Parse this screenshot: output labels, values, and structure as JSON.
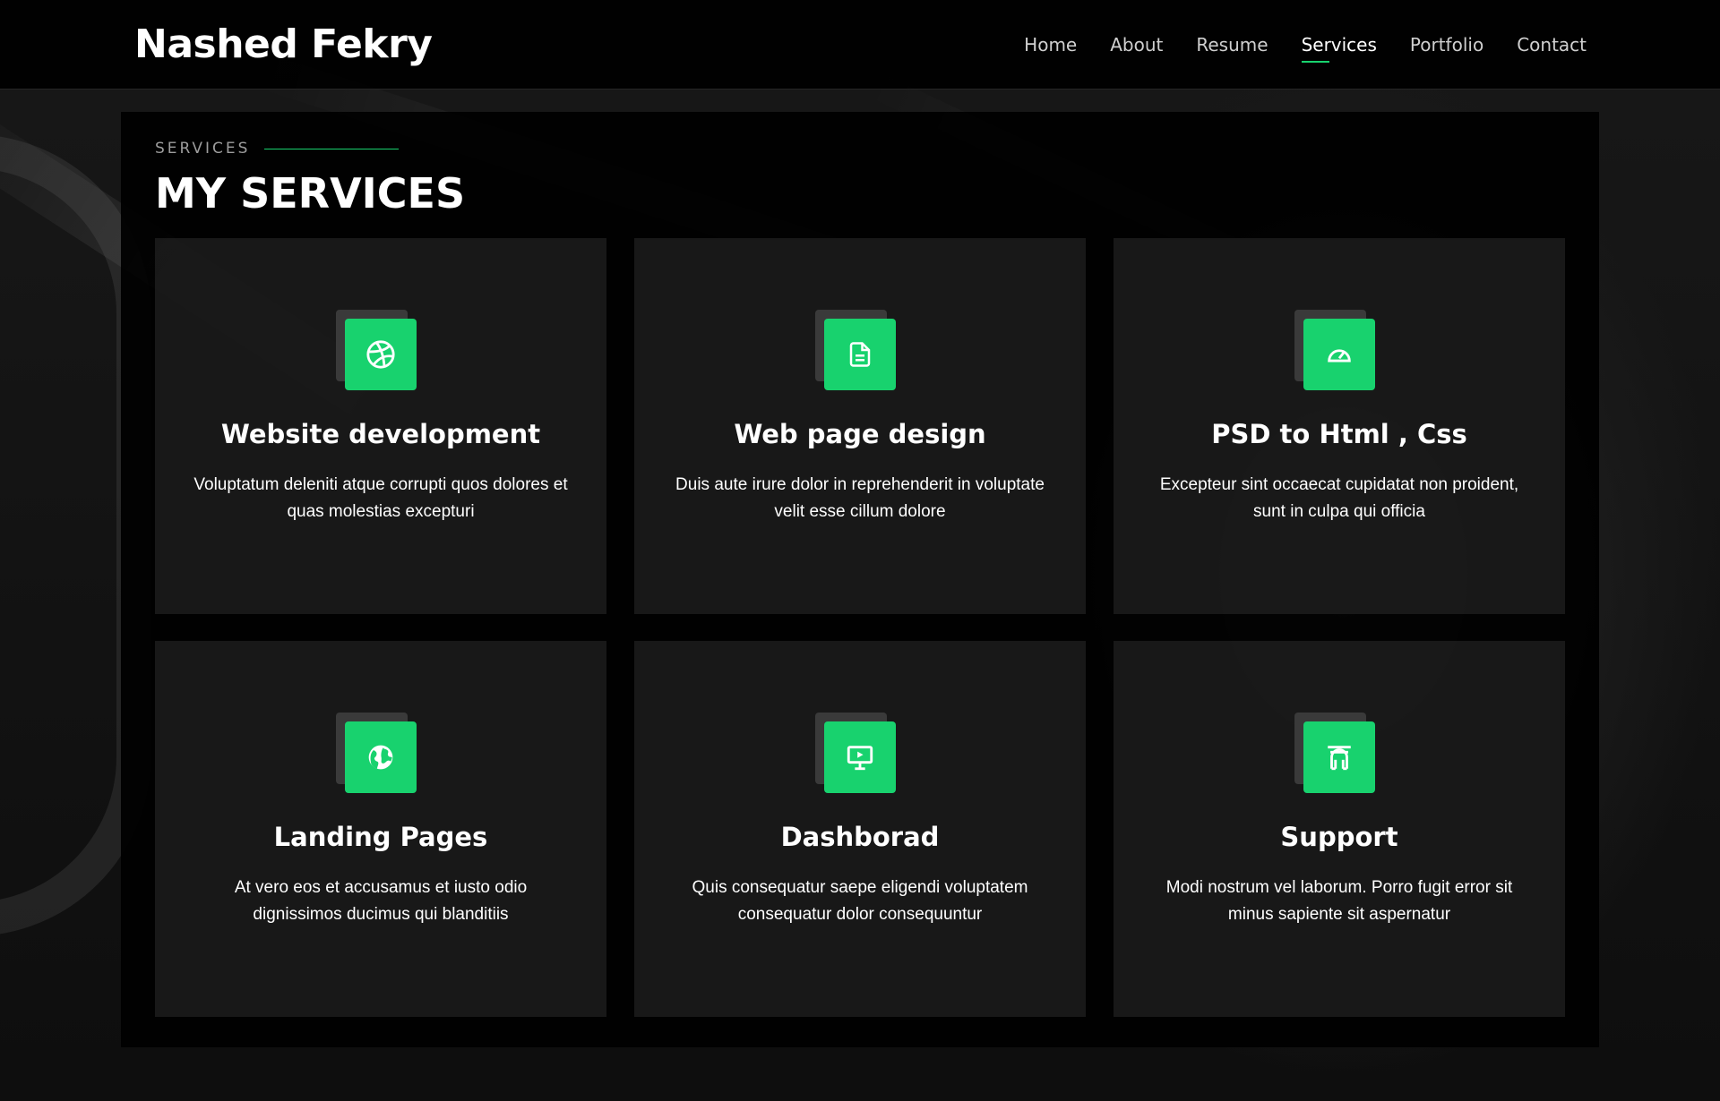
{
  "header": {
    "logo": "Nashed Fekry",
    "nav": [
      {
        "label": "Home"
      },
      {
        "label": "About"
      },
      {
        "label": "Resume"
      },
      {
        "label": "Services",
        "active": true
      },
      {
        "label": "Portfolio"
      },
      {
        "label": "Contact"
      }
    ]
  },
  "section": {
    "subtitle": "SERVICES",
    "title": "MY SERVICES",
    "services": [
      {
        "icon": "dribbble-icon",
        "title": "Website development",
        "description": "Voluptatum deleniti atque corrupti quos dolores et quas molestias excepturi"
      },
      {
        "icon": "file-text-icon",
        "title": "Web page design",
        "description": "Duis aute irure dolor in reprehenderit in voluptate velit esse cillum dolore"
      },
      {
        "icon": "speedometer-icon",
        "title": "PSD to Html , Css",
        "description": "Excepteur sint occaecat cupidatat non proident, sunt in culpa qui officia"
      },
      {
        "icon": "globe-icon",
        "title": "Landing Pages",
        "description": "At vero eos et accusamus et iusto odio dignissimos ducimus qui blanditiis"
      },
      {
        "icon": "presentation-icon",
        "title": "Dashborad",
        "description": "Quis consequatur saepe eligendi voluptatem consequatur dolor consequuntur"
      },
      {
        "icon": "arch-icon",
        "title": "Support",
        "description": "Modi nostrum vel laborum. Porro fugit error sit minus sapiente sit aspernatur"
      }
    ]
  },
  "colors": {
    "accent": "#18d26e",
    "background": "#000000",
    "card": "#262626"
  }
}
